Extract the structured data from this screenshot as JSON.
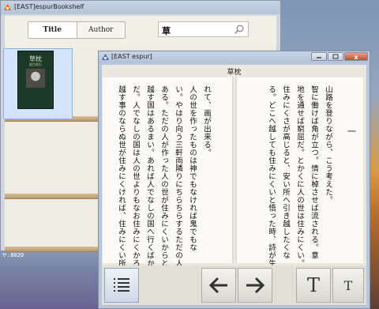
{
  "desktop": {
    "label": "ヤ:8020"
  },
  "bookshelf": {
    "title": "[EAST]espurBookshelf",
    "sort_title": "Title",
    "sort_author": "Author",
    "search_value": "草",
    "book": {
      "title": "草枕",
      "author": "夏目漱石"
    }
  },
  "reader": {
    "title": "[EAST espur]",
    "book_title": "草枕",
    "page_number": "一",
    "right_page_columns": [
      "山路を登りながら、こう考えた。",
      "智に働けば角が立つ。情に棹させば流される。意",
      "地を通せば窮屈だ。とかくに人の世は住みにくい。",
      "住みにくさが高じると、安い所へ引き越したくな",
      "る。どこへ越しても住みにくいと悟った時、詩が生"
    ],
    "left_page_columns": [
      "れて、画が出来る。",
      "人の世を作ったものは神でもなければ鬼でもな",
      "い。やはり向う三軒両隣りにちらちらするただの人で",
      "ある。ただの人が作った人の世が住みにくいからとて",
      "越す国はあるまい。あれば人でなしの国へ行くばかり",
      "だ。人でなしの国は人の世よりもなお住みにくかろう。",
      "越す事のならぬ世が住みにくければ、住みにくい所"
    ],
    "controls": {
      "close": "x"
    }
  }
}
